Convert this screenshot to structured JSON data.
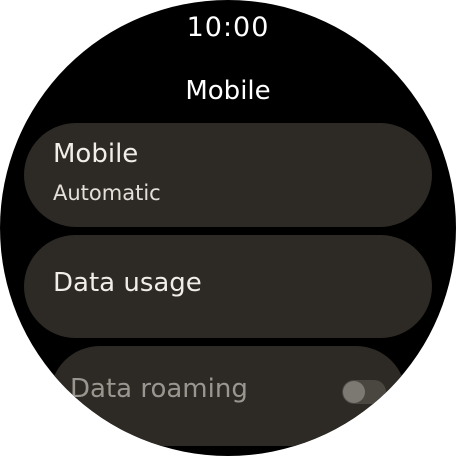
{
  "status_bar": {
    "time": "10:00"
  },
  "screen": {
    "title": "Mobile"
  },
  "items": [
    {
      "label": "Mobile",
      "value": "Automatic"
    },
    {
      "label": "Data usage"
    },
    {
      "label": "Data roaming",
      "toggle_on": false
    }
  ],
  "colors": {
    "background": "#000000",
    "chip": "#2d2a25",
    "text": "#f1ede8"
  }
}
